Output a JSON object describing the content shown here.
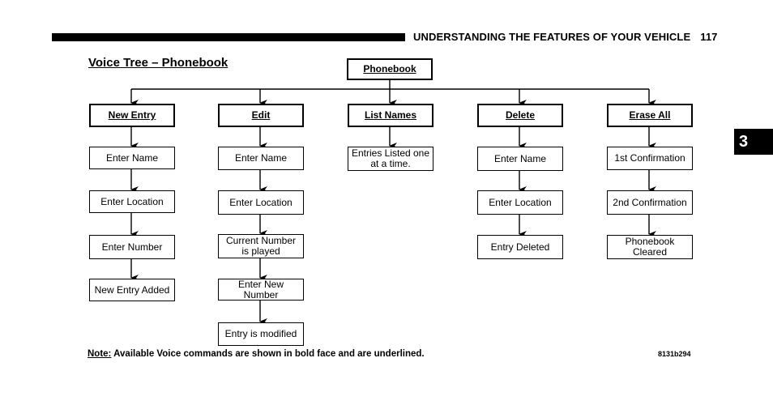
{
  "header": {
    "section_title": "UNDERSTANDING THE FEATURES OF YOUR VEHICLE",
    "page_number": "117",
    "chapter_tab": "3"
  },
  "diagram": {
    "title": "Voice Tree – Phonebook",
    "root": "Phonebook",
    "branches": [
      {
        "command": "New Entry",
        "steps": [
          "Enter Name",
          "Enter Location",
          "Enter Number",
          "New Entry Added"
        ]
      },
      {
        "command": "Edit",
        "steps": [
          "Enter Name",
          "Enter Location",
          "Current Number is played",
          "Enter New Number",
          "Entry is modified"
        ]
      },
      {
        "command": "List Names",
        "steps": [
          "Entries Listed one at a time."
        ]
      },
      {
        "command": "Delete",
        "steps": [
          "Enter Name",
          "Enter Location",
          "Entry Deleted"
        ]
      },
      {
        "command": "Erase All",
        "steps": [
          "1st Confirmation",
          "2nd Confirmation",
          "Phonebook Cleared"
        ]
      }
    ]
  },
  "footer": {
    "note_label": "Note:",
    "note_text": " Available Voice commands are shown in bold face and are underlined.",
    "figure_code": "8131b294"
  }
}
